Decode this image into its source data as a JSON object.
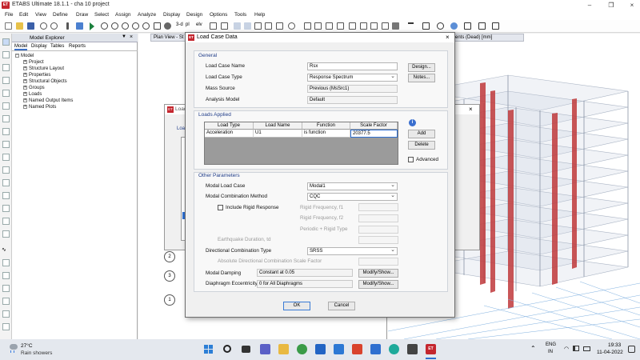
{
  "app": {
    "title": "ETABS Ultimate 18.1.1 - cha 10 project",
    "logo": "ET"
  },
  "menu": [
    "File",
    "Edit",
    "View",
    "Define",
    "Draw",
    "Select",
    "Assign",
    "Analyze",
    "Display",
    "Design",
    "Options",
    "Tools",
    "Help"
  ],
  "toolbar": {
    "view_3d": "3-d",
    "view_pl": "pl",
    "view_elev": "elv"
  },
  "explorer": {
    "title": "Model Explorer",
    "pin": "▼",
    "close": "×",
    "tabs": [
      "Model",
      "Display",
      "Tables",
      "Reports"
    ],
    "root": "Model",
    "items": [
      "Project",
      "Structure Layout",
      "Properties",
      "Structural Objects",
      "Groups",
      "Loads",
      "Named Output Items",
      "Named Plots"
    ]
  },
  "tabs": {
    "plan": "Plan View - St",
    "elevation": "ents (Dead) [mm]"
  },
  "background_dialog": {
    "title": "Load",
    "label": "Load"
  },
  "dialog": {
    "title": "Load Case Data",
    "general": {
      "title": "General",
      "name_label": "Load Case Name",
      "name_value": "Rsx",
      "design_btn": "Design...",
      "type_label": "Load Case Type",
      "type_value": "Response Spectrum",
      "notes_btn": "Notes...",
      "mass_label": "Mass Source",
      "mass_value": "Previous (MsSrc1)",
      "analysis_label": "Analysis Model",
      "analysis_value": "Default"
    },
    "loads": {
      "title": "Loads Applied",
      "info_icon": "i",
      "columns": [
        "Load Type",
        "Load Name",
        "Function",
        "Scale Factor"
      ],
      "rows": [
        {
          "type": "Acceleration",
          "name": "U1",
          "function": "is function",
          "scale": "20377.5"
        }
      ],
      "add_btn": "Add",
      "delete_btn": "Delete",
      "advanced_label": "Advanced"
    },
    "params": {
      "title": "Other Parameters",
      "modal_case_label": "Modal Load Case",
      "modal_case_value": "Modal1",
      "combo_method_label": "Modal Combination Method",
      "combo_method_value": "CQC",
      "rigid_label": "Include Rigid Response",
      "rigid_f1_label": "Rigid Frequency, f1",
      "rigid_f2_label": "Rigid Frequency, f2",
      "periodic_label": "Periodic + Rigid Type",
      "eq_duration_label": "Earthquake Duration, td",
      "dir_combo_label": "Directional Combination Type",
      "dir_combo_value": "SRSS",
      "abs_scale_label": "Absolute Directional Combination Scale Factor",
      "damping_label": "Modal Damping",
      "damping_value": "Constant at 0.05",
      "damping_btn": "Modify/Show...",
      "eccentricity_label": "Diaphragm Eccentricity",
      "eccentricity_value": "0 for All Diaphragms",
      "eccentricity_btn": "Modify/Show..."
    },
    "ok": "OK",
    "cancel": "Cancel"
  },
  "drawing": {
    "bubbles": [
      "2",
      "3",
      "1"
    ]
  },
  "taskbar": {
    "weather_temp": "27°C",
    "weather_desc": "Rain showers",
    "lang_top": "ENG",
    "lang_bottom": "IN",
    "time": "19:33",
    "date": "11-04-2022"
  }
}
